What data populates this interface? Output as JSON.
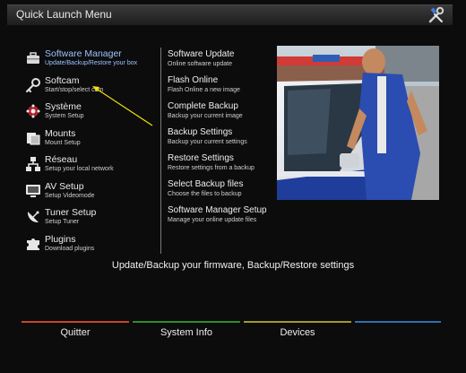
{
  "window": {
    "title": "Quick Launch Menu",
    "tools_icon": "tools-icon"
  },
  "left_menu": [
    {
      "label": "Software Manager",
      "sub": "Update/Backup/Restore your box",
      "icon": "toolbox-icon",
      "selected": true
    },
    {
      "label": "Softcam",
      "sub": "Start/stop/select cam",
      "icon": "key-icon",
      "selected": false
    },
    {
      "label": "Système",
      "sub": "System Setup",
      "icon": "gears-icon",
      "selected": false
    },
    {
      "label": "Mounts",
      "sub": "Mount Setup",
      "icon": "mount-icon",
      "selected": false
    },
    {
      "label": "Réseau",
      "sub": "Setup your local network",
      "icon": "network-icon",
      "selected": false
    },
    {
      "label": "AV Setup",
      "sub": "Setup Videomode",
      "icon": "monitor-icon",
      "selected": false
    },
    {
      "label": "Tuner Setup",
      "sub": "Setup Tuner",
      "icon": "satellite-icon",
      "selected": false
    },
    {
      "label": "Plugins",
      "sub": "Download plugins",
      "icon": "puzzle-icon",
      "selected": false
    }
  ],
  "mid_menu": [
    {
      "label": "Software Update",
      "sub": "Online software update"
    },
    {
      "label": "Flash Online",
      "sub": "Flash Online a new image"
    },
    {
      "label": "Complete Backup",
      "sub": "Backup your current image"
    },
    {
      "label": "Backup Settings",
      "sub": "Backup your current settings"
    },
    {
      "label": "Restore Settings",
      "sub": "Restore settings from a backup"
    },
    {
      "label": "Select Backup files",
      "sub": "Choose the files to backup"
    },
    {
      "label": "Software Manager Setup",
      "sub": "Manage your online update files"
    }
  ],
  "preview": {
    "name": "tv-preview"
  },
  "description": "Update/Backup your firmware, Backup/Restore settings",
  "keys": {
    "red": {
      "label": "Quitter",
      "color": "#c8452c"
    },
    "green": {
      "label": "System Info",
      "color": "#2e8a2e"
    },
    "yellow": {
      "label": "Devices",
      "color": "#a09a2a"
    },
    "blue": {
      "label": "",
      "color": "#2f6fb2"
    }
  },
  "annotation_arrow_color": "#f2e400"
}
